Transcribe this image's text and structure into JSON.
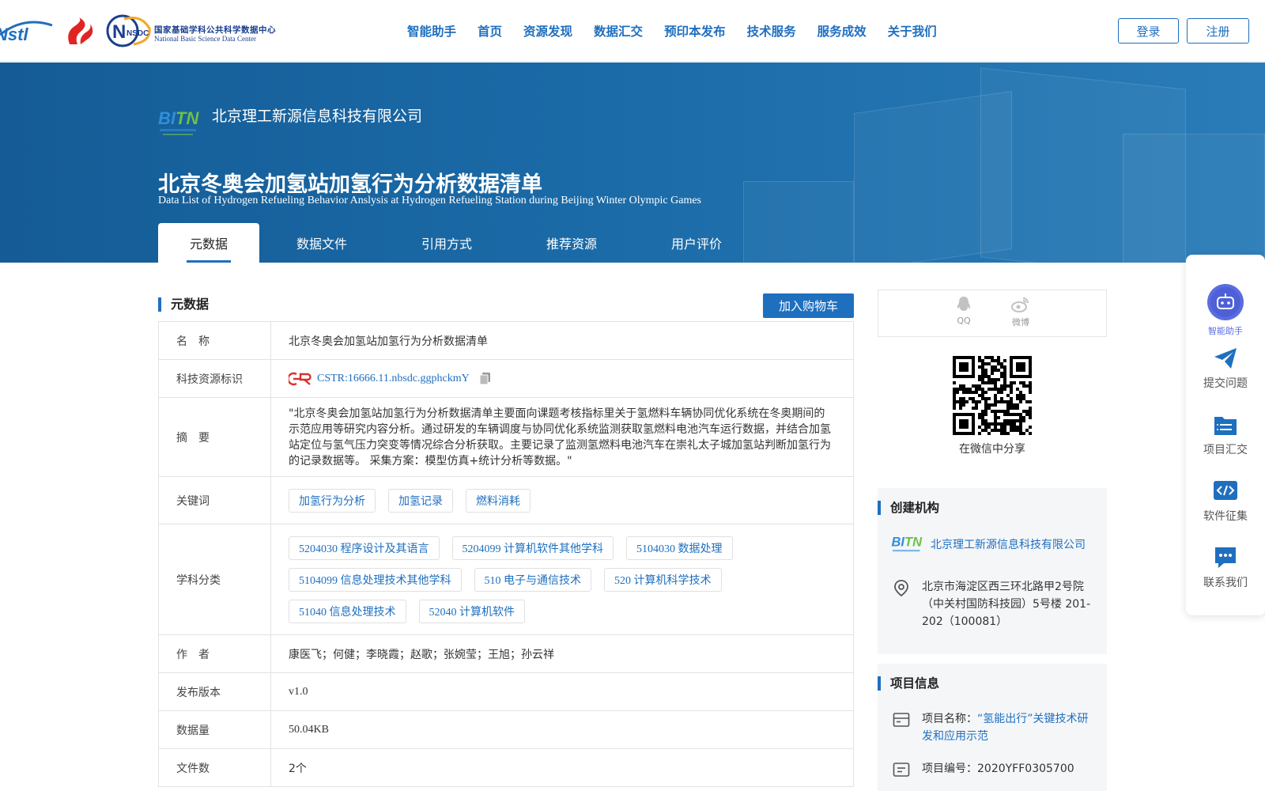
{
  "nav": {
    "logo_nstl": "Nstl",
    "logo_nsdc": "NSDC",
    "logo_nsdc_cn": "国家基础学科公共科学数据中心",
    "logo_nsdc_en": "National Basic Science Data Center",
    "items": [
      "智能助手",
      "首页",
      "资源发现",
      "数据汇交",
      "预印本发布",
      "技术服务",
      "服务成效",
      "关于我们"
    ],
    "login": "登录",
    "register": "注册"
  },
  "banner": {
    "org_name": "北京理工新源信息科技有限公司",
    "title_cn": "北京冬奥会加氢站加氢行为分析数据清单",
    "title_en": "Data List of Hydrogen Refueling Behavior Anslysis at Hydrogen Refueling Station during Beijing Winter Olympic Games",
    "tabs": [
      "元数据",
      "数据文件",
      "引用方式",
      "推荐资源",
      "用户评价"
    ]
  },
  "metadata": {
    "section_title": "元数据",
    "cart_button": "加入购物车",
    "name_label": "名　称",
    "name_value": "北京冬奥会加氢站加氢行为分析数据清单",
    "cstr_label": "科技资源标识",
    "cstr_value": "CSTR:16666.11.nbsdc.ggphckmY",
    "abstract_label": "摘　要",
    "abstract_value": "\"北京冬奥会加氢站加氢行为分析数据清单主要面向课题考核指标里关于氢燃料车辆协同优化系统在冬奥期间的示范应用等研究内容分析。通过研发的车辆调度与协同优化系统监测获取氢燃料电池汽车运行数据，并结合加氢站定位与氢气压力突变等情况综合分析获取。主要记录了监测氢燃料电池汽车在崇礼太子城加氢站判断加氢行为的记录数据等。 采集方案：模型仿真+统计分析等数据。\"",
    "keywords_label": "关键词",
    "keywords": [
      "加氢行为分析",
      "加氢记录",
      "燃料消耗"
    ],
    "subjects_label": "学科分类",
    "subjects": [
      "5204030 程序设计及其语言",
      "5204099 计算机软件其他学科",
      "5104030 数据处理",
      "5104099 信息处理技术其他学科",
      "510 电子与通信技术",
      "520 计算机科学技术",
      "51040 信息处理技术",
      "52040 计算机软件"
    ],
    "authors_label": "作　者",
    "authors_value": "康医飞；何健；李晓霞；赵歌；张婉莹；王旭；孙云祥",
    "version_label": "发布版本",
    "version_value": "v1.0",
    "size_label": "数据量",
    "size_value": "50.04KB",
    "files_label": "文件数",
    "files_value": "2个"
  },
  "share": {
    "qq": "QQ",
    "weibo": "微博",
    "wechat_caption": "在微信中分享"
  },
  "creator": {
    "title": "创建机构",
    "org": "北京理工新源信息科技有限公司",
    "address": "北京市海淀区西三环北路甲2号院（中关村国防科技园）5号楼 201-202（100081）"
  },
  "project": {
    "title": "项目信息",
    "name_label": "项目名称：",
    "name_value": "“氢能出行”关键技术研发和应用示范",
    "code_label": "项目编号：",
    "code_value": "2020YFF0305700"
  },
  "floating": {
    "assistant": "智能助手",
    "submit": "提交问题",
    "collect": "项目汇交",
    "software": "软件征集",
    "contact": "联系我们"
  },
  "colors": {
    "primary": "#1f6fbf",
    "banner": "#1a6aa7",
    "assistant": "#5a6de0"
  }
}
